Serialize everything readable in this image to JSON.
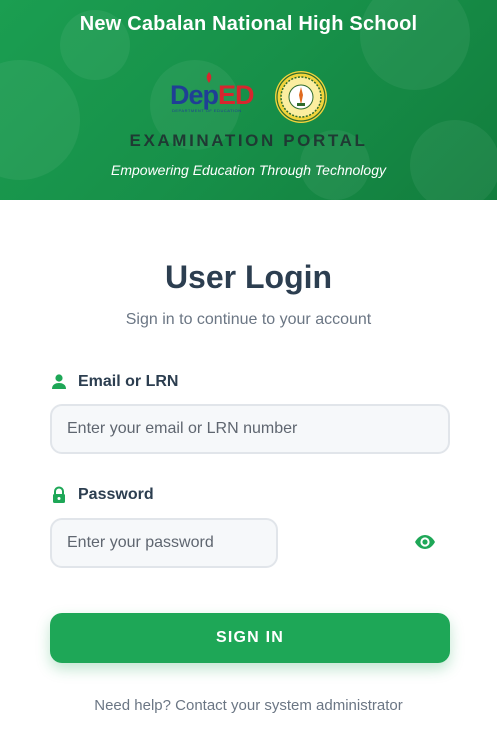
{
  "header": {
    "school_name": "New Cabalan National High School",
    "deped_dep": "Dep",
    "deped_ed": "ED",
    "deped_subtitle": "DEPARTMENT OF EDUCATION",
    "portal_title": "EXAMINATION PORTAL",
    "tagline": "Empowering Education Through Technology",
    "background_color": "#179049",
    "seal_icon": "school-seal-icon",
    "logo_icon": "deped-logo"
  },
  "login": {
    "title": "User Login",
    "subtitle": "Sign in to continue to your account",
    "email": {
      "label": "Email or LRN",
      "placeholder": "Enter your email or LRN number",
      "value": "",
      "icon": "user-icon"
    },
    "password": {
      "label": "Password",
      "placeholder": "Enter your password",
      "value": "",
      "icon": "lock-icon",
      "toggle_icon": "eye-icon"
    },
    "submit_label": "SIGN IN",
    "help_text": "Need help? Contact your system administrator",
    "accent_color": "#1ea757"
  }
}
